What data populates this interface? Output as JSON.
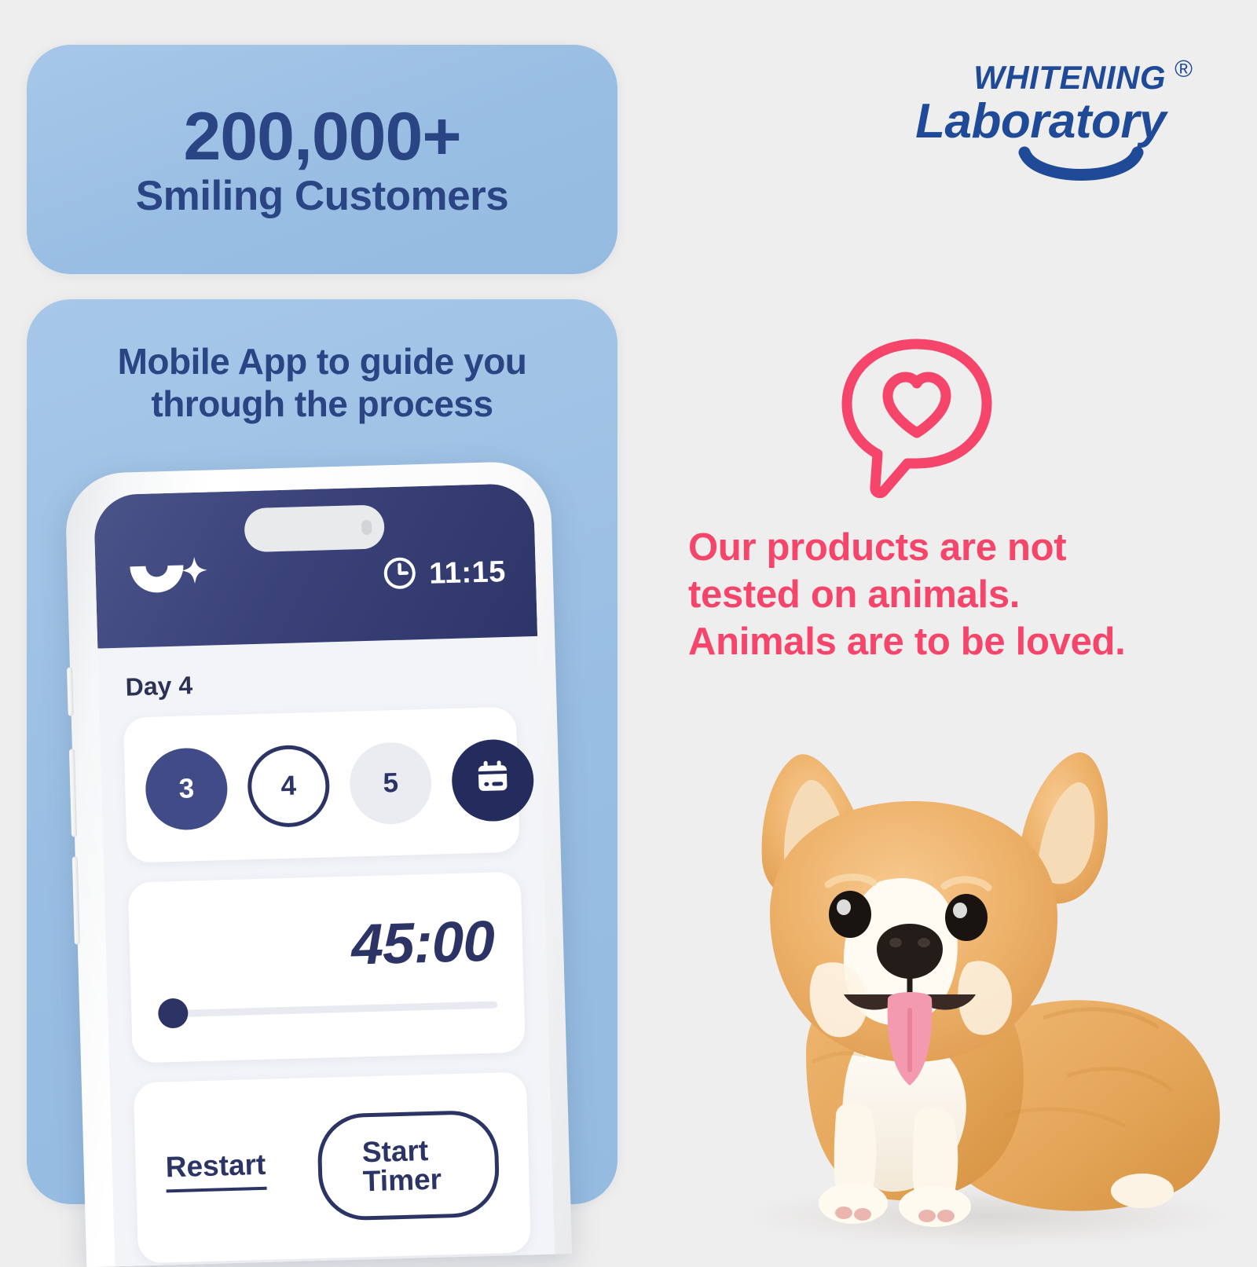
{
  "page": {
    "background_color": "#efeeee",
    "card_blue": "#9cc1e6",
    "navy": "#2a4484",
    "deep_navy": "#232c5c",
    "pink": "#f6456b",
    "logo_blue": "#1f4a97"
  },
  "stat_card": {
    "number": "200,000+",
    "label": "Smiling Customers"
  },
  "app_card": {
    "heading_line1": "Mobile App to guide you",
    "heading_line2": "through the process"
  },
  "phone": {
    "statusbar": {
      "brand_icon": "smile-sparkle-logo-icon",
      "clock_icon": "clock-icon",
      "time": "11:15"
    },
    "day_label": "Day 4",
    "days": [
      {
        "value": "3",
        "state": "completed"
      },
      {
        "value": "4",
        "state": "current"
      },
      {
        "value": "5",
        "state": "upcoming"
      }
    ],
    "calendar_button_icon": "calendar-icon",
    "timer": {
      "value": "45:00",
      "slider_position_percent": 0
    },
    "actions": {
      "restart_label": "Restart",
      "start_label": "Start Timer"
    }
  },
  "logo": {
    "line1": "WHITENING",
    "line2": "Laboratory",
    "registered_mark": "®",
    "smile_icon": "smile-swoosh-icon"
  },
  "cruelty_free": {
    "icon": "speech-bubble-heart-icon",
    "line1": "Our products are not",
    "line2": "tested on animals.",
    "line3": "Animals are to be loved."
  },
  "photo": {
    "subject": "corgi-dog-photo"
  }
}
